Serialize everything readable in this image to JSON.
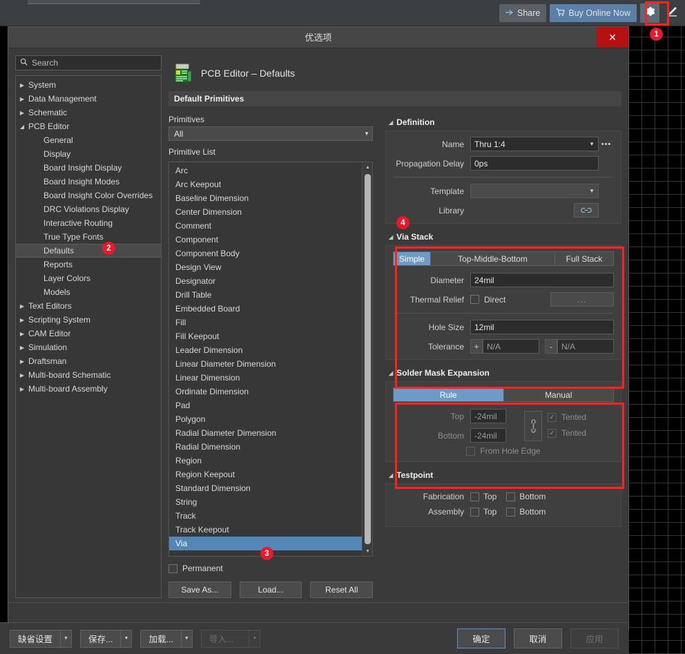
{
  "toolbar": {
    "share_label": "Share",
    "buy_label": "Buy Online Now",
    "share_icon": "arrow-share-icon",
    "buy_icon": "cart-icon",
    "gear_icon": "gear-icon",
    "pen_icon": "pen-icon"
  },
  "badges": {
    "one": "1",
    "two": "2",
    "three": "3",
    "four": "4"
  },
  "dialog": {
    "title": "优选项",
    "close_label": "✕"
  },
  "nav": {
    "search_placeholder": "Search",
    "search_value": "",
    "search_icon": "search-icon",
    "items": [
      {
        "label": "System",
        "level": 0,
        "expanded": false,
        "selected": false
      },
      {
        "label": "Data Management",
        "level": 0,
        "expanded": false,
        "selected": false
      },
      {
        "label": "Schematic",
        "level": 0,
        "expanded": false,
        "selected": false
      },
      {
        "label": "PCB Editor",
        "level": 0,
        "expanded": true,
        "selected": false
      },
      {
        "label": "General",
        "level": 1,
        "expanded": false,
        "selected": false
      },
      {
        "label": "Display",
        "level": 1,
        "expanded": false,
        "selected": false
      },
      {
        "label": "Board Insight Display",
        "level": 1,
        "expanded": false,
        "selected": false
      },
      {
        "label": "Board Insight Modes",
        "level": 1,
        "expanded": false,
        "selected": false
      },
      {
        "label": "Board Insight Color Overrides",
        "level": 1,
        "expanded": false,
        "selected": false
      },
      {
        "label": "DRC Violations Display",
        "level": 1,
        "expanded": false,
        "selected": false
      },
      {
        "label": "Interactive Routing",
        "level": 1,
        "expanded": false,
        "selected": false
      },
      {
        "label": "True Type Fonts",
        "level": 1,
        "expanded": false,
        "selected": false
      },
      {
        "label": "Defaults",
        "level": 1,
        "expanded": false,
        "selected": true
      },
      {
        "label": "Reports",
        "level": 1,
        "expanded": false,
        "selected": false
      },
      {
        "label": "Layer Colors",
        "level": 1,
        "expanded": false,
        "selected": false
      },
      {
        "label": "Models",
        "level": 1,
        "expanded": false,
        "selected": false
      },
      {
        "label": "Text Editors",
        "level": 0,
        "expanded": false,
        "selected": false
      },
      {
        "label": "Scripting System",
        "level": 0,
        "expanded": false,
        "selected": false
      },
      {
        "label": "CAM Editor",
        "level": 0,
        "expanded": false,
        "selected": false
      },
      {
        "label": "Simulation",
        "level": 0,
        "expanded": false,
        "selected": false
      },
      {
        "label": "Draftsman",
        "level": 0,
        "expanded": false,
        "selected": false
      },
      {
        "label": "Multi-board Schematic",
        "level": 0,
        "expanded": false,
        "selected": false
      },
      {
        "label": "Multi-board Assembly",
        "level": 0,
        "expanded": false,
        "selected": false
      }
    ]
  },
  "content": {
    "page_icon": "pcb-board-icon",
    "page_title": "PCB Editor – Defaults",
    "section_bar": "Default Primitives"
  },
  "primitives": {
    "filter_label": "Primitives",
    "filter_value": "All",
    "list_label": "Primitive List",
    "items": [
      "Arc",
      "Arc Keepout",
      "Baseline Dimension",
      "Center Dimension",
      "Comment",
      "Component",
      "Component Body",
      "Design View",
      "Designator",
      "Drill Table",
      "Embedded Board",
      "Fill",
      "Fill Keepout",
      "Leader Dimension",
      "Linear Diameter Dimension",
      "Linear Dimension",
      "Ordinate Dimension",
      "Pad",
      "Polygon",
      "Radial Diameter Dimension",
      "Radial Dimension",
      "Region",
      "Region Keepout",
      "Standard Dimension",
      "String",
      "Track",
      "Track Keepout",
      "Via"
    ],
    "selected": "Via",
    "permanent_label": "Permanent",
    "permanent_checked": false,
    "save_as_label": "Save As...",
    "load_label": "Load...",
    "reset_all_label": "Reset All"
  },
  "definition": {
    "group_title": "Definition",
    "name_label": "Name",
    "name_value": "Thru 1:4",
    "name_more_icon": "ellipsis-icon",
    "propagation_label": "Propagation Delay",
    "propagation_value": "0ps",
    "template_label": "Template",
    "template_value": "",
    "library_label": "Library",
    "library_icon": "link-icon"
  },
  "via_stack": {
    "group_title": "Via Stack",
    "modes": [
      "Simple",
      "Top-Middle-Bottom",
      "Full Stack"
    ],
    "active_mode": "Simple",
    "diameter_label": "Diameter",
    "diameter_value": "24mil",
    "thermal_relief_label": "Thermal Relief",
    "thermal_relief_option": "Direct",
    "thermal_relief_checked": false,
    "thermal_more_label": "...",
    "hole_size_label": "Hole Size",
    "hole_size_value": "12mil",
    "tolerance_label": "Tolerance",
    "tolerance_plus_sign": "+",
    "tolerance_plus_value": "N/A",
    "tolerance_minus_sign": "-",
    "tolerance_minus_value": "N/A"
  },
  "solder_mask": {
    "group_title": "Solder Mask Expansion",
    "modes": [
      "Rule",
      "Manual"
    ],
    "active_mode": "Rule",
    "top_label": "Top",
    "top_value": "-24mil",
    "bottom_label": "Bottom",
    "bottom_value": "-24mil",
    "link_icon": "chain-link-icon",
    "tented_top_label": "Tented",
    "tented_top_checked": true,
    "tented_bottom_label": "Tented",
    "tented_bottom_checked": true,
    "from_hole_edge_label": "From Hole Edge",
    "from_hole_edge_checked": false
  },
  "testpoint": {
    "group_title": "Testpoint",
    "fabrication_label": "Fabrication",
    "assembly_label": "Assembly",
    "top_label": "Top",
    "bottom_label": "Bottom",
    "fabrication_top_checked": false,
    "fabrication_bottom_checked": false,
    "assembly_top_checked": false,
    "assembly_bottom_checked": false
  },
  "footer": {
    "defaults_label": "缺省设置",
    "save_label": "保存...",
    "load_label": "加载...",
    "import_label": "导入...",
    "ok_label": "确定",
    "cancel_label": "取消",
    "apply_label": "应用"
  },
  "colors": {
    "accent_blue": "#6d9bc9",
    "selection_blue": "#5387b8",
    "highlight_red": "#ff2020",
    "badge_red": "#e8192c",
    "close_red": "#b51111",
    "buy_blue": "#5b7fa6"
  }
}
